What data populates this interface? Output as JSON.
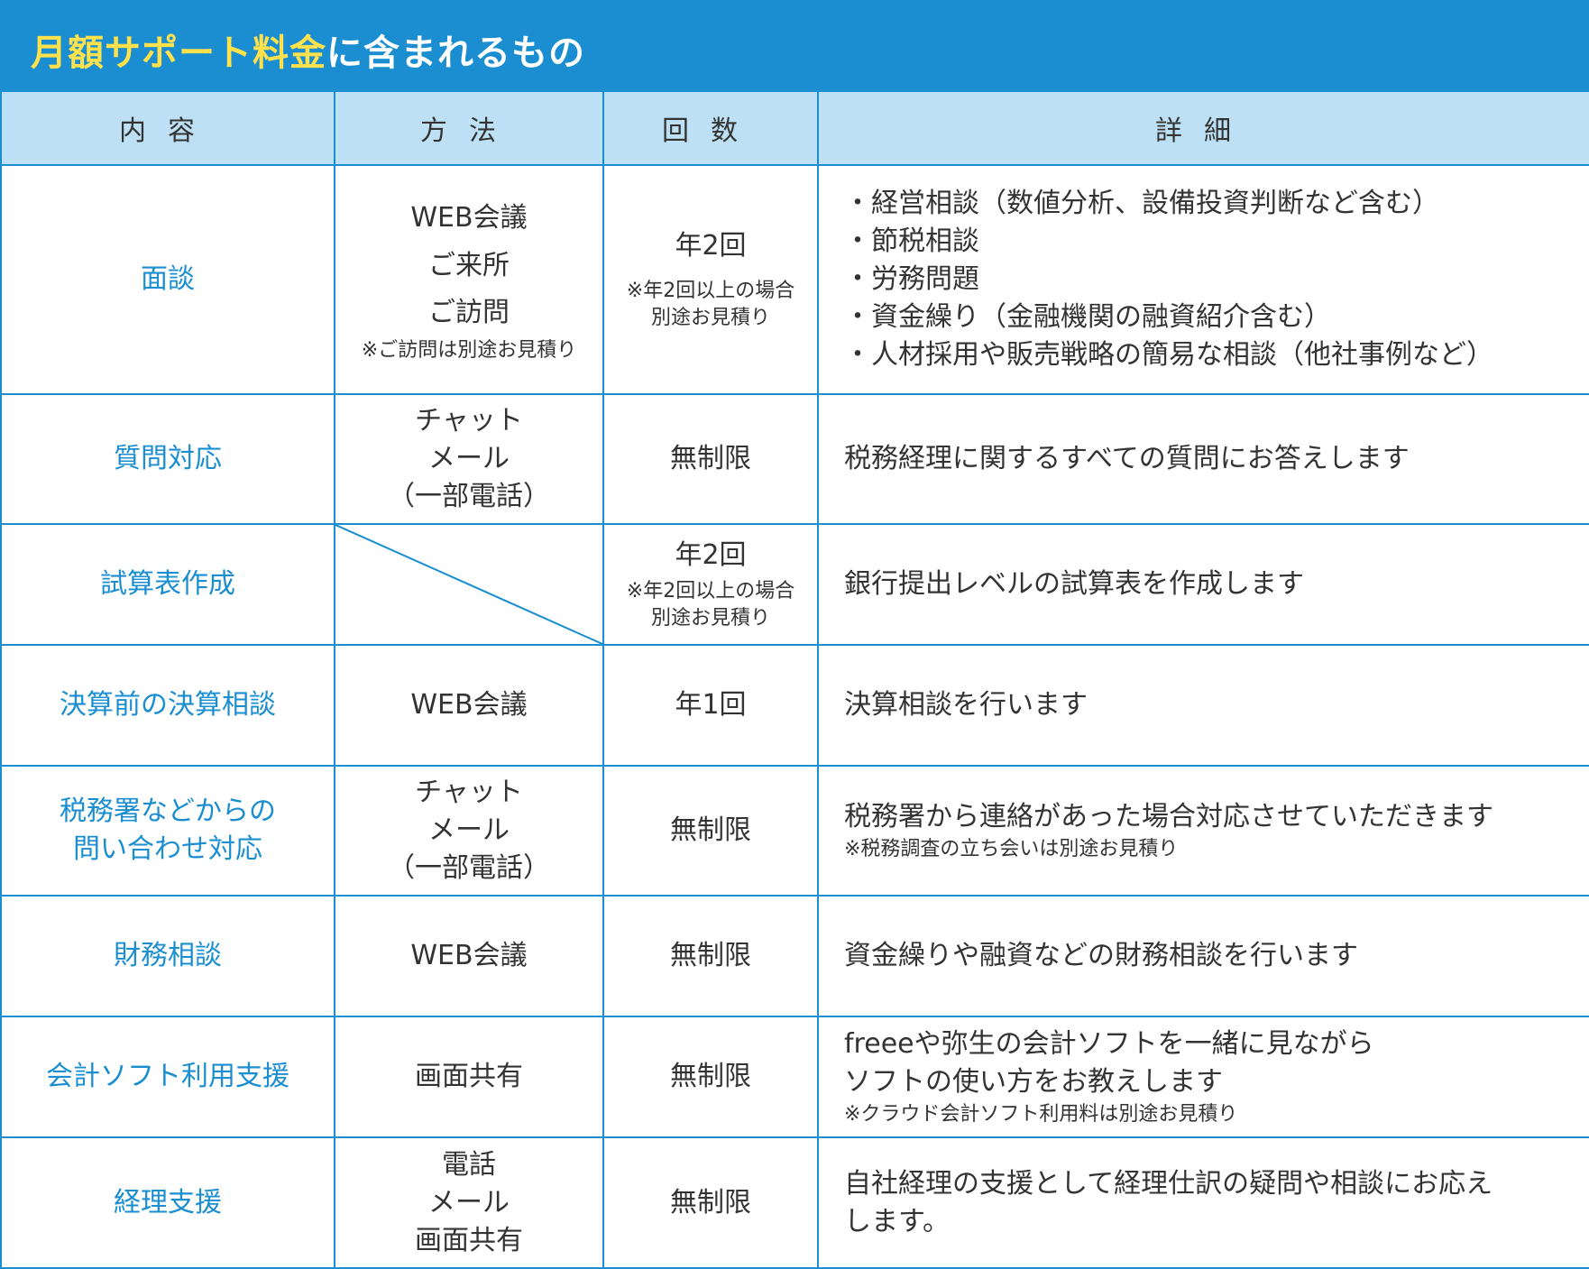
{
  "title": {
    "highlight": "月額サポート料金",
    "rest": "に含まれるもの"
  },
  "headers": [
    "内容",
    "方法",
    "回数",
    "詳細"
  ],
  "rows": [
    {
      "item": [
        "面談"
      ],
      "method": [
        "WEB会議",
        "ご来所",
        "ご訪問"
      ],
      "method_note": "※ご訪問は別途お見積り",
      "count": "年2回",
      "count_note": [
        "※年2回以上の場合",
        "別途お見積り"
      ],
      "details": [
        "・経営相談（数値分析、設備投資判断など含む）",
        "・節税相談",
        "・労務問題",
        "・資金繰り（金融機関の融資紹介含む）",
        "・人材採用や販売戦略の簡易な相談（他社事例など）"
      ]
    },
    {
      "item": [
        "質問対応"
      ],
      "method": [
        "チャット",
        "メール",
        "（一部電話）"
      ],
      "count": "無制限",
      "details": [
        "税務経理に関するすべての質問にお答えします"
      ]
    },
    {
      "item": [
        "試算表作成"
      ],
      "count": "年2回",
      "count_note": [
        "※年2回以上の場合",
        "別途お見積り"
      ],
      "details": [
        "銀行提出レベルの試算表を作成します"
      ]
    },
    {
      "item": [
        "決算前の決算相談"
      ],
      "method": [
        "WEB会議"
      ],
      "count": "年1回",
      "details": [
        "決算相談を行います"
      ]
    },
    {
      "item": [
        "税務署などからの",
        "問い合わせ対応"
      ],
      "method": [
        "チャット",
        "メール",
        "（一部電話）"
      ],
      "count": "無制限",
      "details": [
        "税務署から連絡があった場合対応させていただきます"
      ],
      "details_note": "※税務調査の立ち会いは別途お見積り"
    },
    {
      "item": [
        "財務相談"
      ],
      "method": [
        "WEB会議"
      ],
      "count": "無制限",
      "details": [
        "資金繰りや融資などの財務相談を行います"
      ]
    },
    {
      "item": [
        "会計ソフト利用支援"
      ],
      "method": [
        "画面共有"
      ],
      "count": "無制限",
      "details": [
        "freeeや弥生の会計ソフトを一緒に見ながら",
        "ソフトの使い方をお教えします"
      ],
      "details_note": "※クラウド会計ソフト利用料は別途お見積り"
    },
    {
      "item": [
        "経理支援"
      ],
      "method": [
        "電話",
        "メール",
        "画面共有"
      ],
      "count": "無制限",
      "details": [
        "自社経理の支援として経理仕訳の疑問や相談にお応え",
        "します。"
      ]
    }
  ],
  "colors": {
    "accent": "#1a8ed0",
    "header_bg": "#bde0f4",
    "title_highlight": "#ffe24b",
    "text": "#333333"
  }
}
